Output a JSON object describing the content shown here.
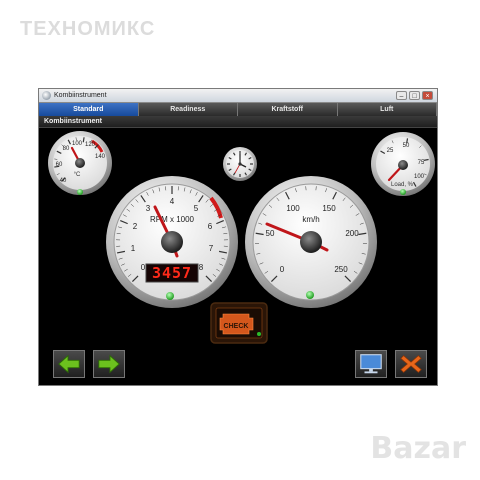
{
  "watermarks": {
    "top": "ТЕХНОМИКС",
    "bottom": "Bazar"
  },
  "window": {
    "title": "Kombiinstrument",
    "controls": [
      "–",
      "□",
      "×"
    ]
  },
  "tabs": [
    {
      "label": "Standard",
      "active": true
    },
    {
      "label": "Readiness",
      "active": false
    },
    {
      "label": "Kraftstoff",
      "active": false
    },
    {
      "label": "Luft",
      "active": false
    }
  ],
  "section_title": "Kombiinstrument",
  "gauges": {
    "temperature": {
      "labels": [
        "40",
        "60",
        "80",
        "100",
        "120",
        "140"
      ],
      "unit": "°C",
      "value": 80
    },
    "rpm": {
      "labels": [
        "0",
        "1",
        "2",
        "3",
        "4",
        "5",
        "6",
        "7",
        "8"
      ],
      "unit": "RPM x 1000",
      "readout": "3457",
      "value": 3.457
    },
    "speed": {
      "labels": [
        "0",
        "50",
        "100",
        "150",
        "200",
        "250"
      ],
      "unit": "km/h",
      "value": 55
    },
    "load": {
      "labels": [
        "25",
        "50",
        "75",
        "100"
      ],
      "unit": "Load, %",
      "value": 0
    }
  },
  "check_engine": {
    "label": "CHECK"
  },
  "colors": {
    "accent_tab": "#1f58b0",
    "needle": "#c0161a",
    "indicator": "#2bbb2b",
    "nav_green": "#6cc11e",
    "close_orange": "#e8661a",
    "monitor_blue": "#4a8ad8"
  }
}
